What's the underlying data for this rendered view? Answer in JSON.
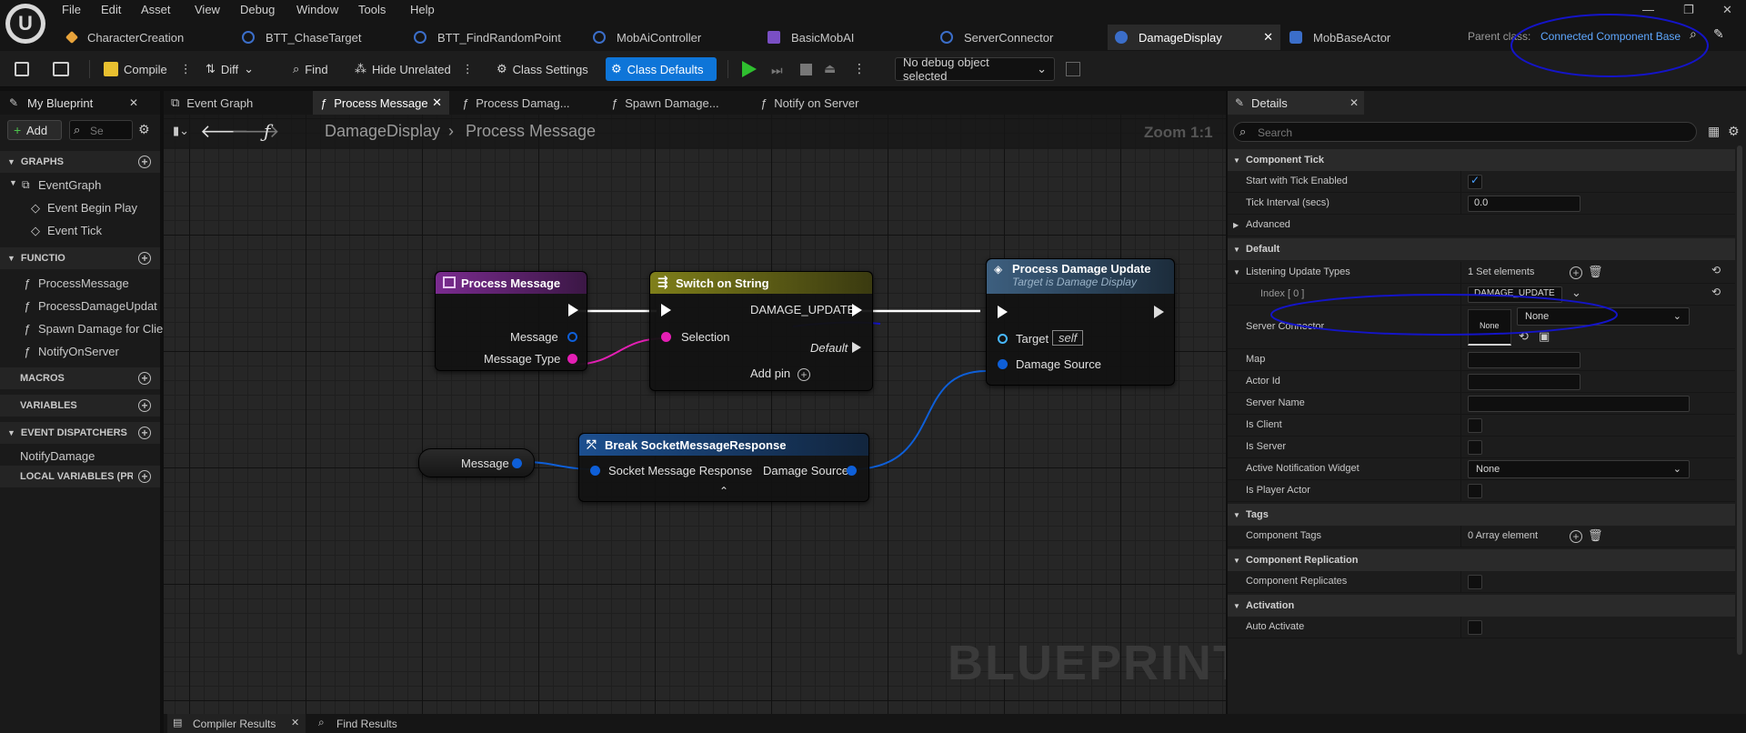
{
  "menu": [
    "File",
    "Edit",
    "Asset",
    "View",
    "Debug",
    "Window",
    "Tools",
    "Help"
  ],
  "asset_tabs": [
    {
      "label": "CharacterCreation",
      "icon": "blueprint-icon",
      "color": "#e8a33a"
    },
    {
      "label": "BTT_ChaseTarget",
      "icon": "task-icon",
      "color": "#3b6ec9"
    },
    {
      "label": "BTT_FindRandomPoint",
      "icon": "task-icon",
      "color": "#3b6ec9"
    },
    {
      "label": "MobAiController",
      "icon": "controller-icon",
      "color": "#3b6ec9"
    },
    {
      "label": "BasicMobAI",
      "icon": "behavior-tree-icon",
      "color": "#7a4fc4"
    },
    {
      "label": "ServerConnector",
      "icon": "component-icon",
      "color": "#3b6ec9"
    },
    {
      "label": "DamageDisplay",
      "icon": "component-icon",
      "color": "#3b6ec9"
    },
    {
      "label": "MobBaseActor",
      "icon": "actor-icon",
      "color": "#3b6ec9"
    }
  ],
  "parent_class": {
    "label": "Parent class:",
    "value": "Connected Component Base"
  },
  "toolbar": {
    "compile": "Compile",
    "diff": "Diff",
    "find": "Find",
    "hide_unrelated": "Hide Unrelated",
    "class_settings": "Class Settings",
    "class_defaults": "Class Defaults",
    "debug_object": "No debug object selected"
  },
  "my_blueprint": {
    "title": "My Blueprint",
    "add": "Add",
    "search_placeholder": "Se",
    "sections": {
      "graphs": "GRAPHS",
      "functions": "FUNCTIO",
      "macros": "MACROS",
      "variables": "VARIABLES",
      "event_dispatchers": "EVENT DISPATCHERS",
      "local_variables": "LOCAL VARIABLES (PROC"
    },
    "graph_items": [
      "EventGraph",
      "Event Begin Play",
      "Event Tick"
    ],
    "function_items": [
      "ProcessMessage",
      "ProcessDamageUpdat",
      "Spawn Damage for Clie",
      "NotifyOnServer"
    ],
    "dispatcher_items": [
      "NotifyDamage"
    ]
  },
  "graph_tabs": [
    "Event Graph",
    "Process Message",
    "Process Damag...",
    "Spawn Damage...",
    "Notify on Server"
  ],
  "breadcrumb": {
    "root": "DamageDisplay",
    "current": "Process Message",
    "zoom": "Zoom 1:1"
  },
  "watermark": "BLUEPRINT",
  "nodes": {
    "process_message": {
      "title": "Process Message",
      "pins": [
        "Message",
        "Message Type"
      ]
    },
    "switch": {
      "title": "Switch on String",
      "case": "DAMAGE_UPDATE",
      "selection": "Selection",
      "default": "Default",
      "add_pin": "Add pin"
    },
    "process_damage": {
      "title": "Process Damage Update",
      "subtitle": "Target is Damage Display",
      "target": "Target",
      "self": "self",
      "damage_source": "Damage Source"
    },
    "message_var": {
      "label": "Message"
    },
    "break": {
      "title": "Break SocketMessageResponse",
      "input": "Socket Message Response",
      "output": "Damage Source"
    }
  },
  "details": {
    "title": "Details",
    "search_placeholder": "Search",
    "categories": {
      "component_tick": "Component Tick",
      "advanced": "Advanced",
      "default": "Default",
      "tags": "Tags",
      "replication": "Component Replication",
      "activation": "Activation"
    },
    "rows": {
      "start_tick": "Start with Tick Enabled",
      "tick_interval": "Tick Interval (secs)",
      "tick_interval_value": "0.0",
      "listening": "Listening Update Types",
      "listening_value": "1 Set elements",
      "index0": "Index [ 0 ]",
      "index0_value": "DAMAGE_UPDATE",
      "server_connector": "Server Connector",
      "none": "None",
      "map": "Map",
      "actor_id": "Actor Id",
      "server_name": "Server Name",
      "is_client": "Is Client",
      "is_server": "Is Server",
      "active_widget": "Active Notification Widget",
      "is_player_actor": "Is Player Actor",
      "component_tags": "Component Tags",
      "component_tags_value": "0 Array element",
      "component_replicates": "Component Replicates",
      "auto_activate": "Auto Activate"
    }
  },
  "bottom_tabs": [
    "Compiler Results",
    "Find Results"
  ],
  "colors": {
    "accent": "#0e75d8",
    "string_pin": "#e41fb4",
    "struct_pin": "#0e5fd8",
    "annotation": "#1414c8"
  }
}
